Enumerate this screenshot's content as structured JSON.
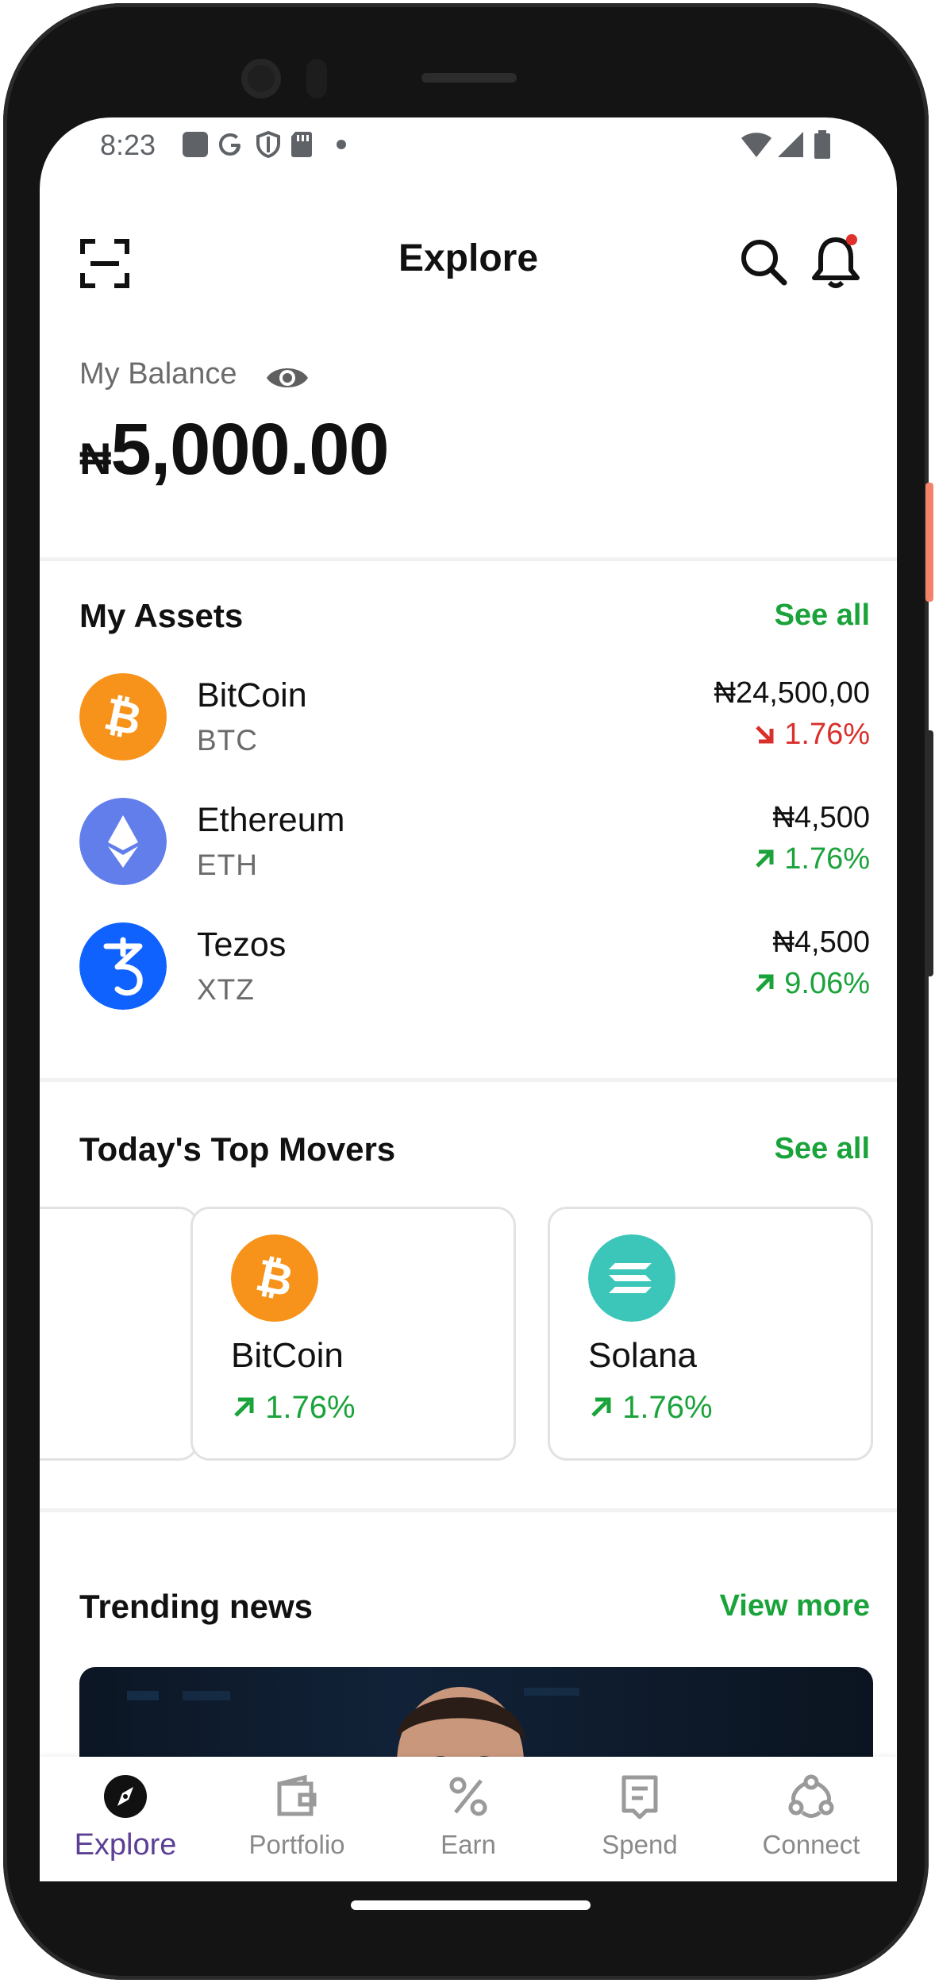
{
  "status_bar": {
    "time": "8:23"
  },
  "header": {
    "title": "Explore"
  },
  "balance": {
    "label": "My Balance",
    "currency": "₦",
    "amount": "5,000.00"
  },
  "assets": {
    "title": "My Assets",
    "see_all": "See all",
    "items": [
      {
        "name": "BitCoin",
        "symbol": "BTC",
        "price": "₦24,500,00",
        "change": "1.76%",
        "direction": "down",
        "icon": "bitcoin-icon",
        "color": "#F7931A"
      },
      {
        "name": "Ethereum",
        "symbol": "ETH",
        "price": "₦4,500",
        "change": "1.76%",
        "direction": "up",
        "icon": "ethereum-icon",
        "color": "#627EEA"
      },
      {
        "name": "Tezos",
        "symbol": "XTZ",
        "price": "₦4,500",
        "change": "9.06%",
        "direction": "up",
        "icon": "tezos-icon",
        "color": "#0F62FE"
      }
    ]
  },
  "movers": {
    "title": "Today's Top Movers",
    "see_all": "See all",
    "items": [
      {
        "name": "BitCoin",
        "change": "1.76%",
        "icon": "bitcoin-icon",
        "color": "#F7931A"
      },
      {
        "name": "Solana",
        "change": "1.76%",
        "icon": "solana-icon",
        "color": "#3BC6B9"
      }
    ]
  },
  "news": {
    "title": "Trending news",
    "view_more": "View more"
  },
  "bottom_nav": {
    "active": "Explore",
    "items": [
      {
        "label": "Explore",
        "icon": "compass-icon"
      },
      {
        "label": "Portfolio",
        "icon": "wallet-icon"
      },
      {
        "label": "Earn",
        "icon": "percent-icon"
      },
      {
        "label": "Spend",
        "icon": "receipt-icon"
      },
      {
        "label": "Connect",
        "icon": "network-icon"
      }
    ]
  },
  "colors": {
    "accent_green": "#1AA33A",
    "negative_red": "#D9302C",
    "active_nav": "#5B3F95"
  }
}
